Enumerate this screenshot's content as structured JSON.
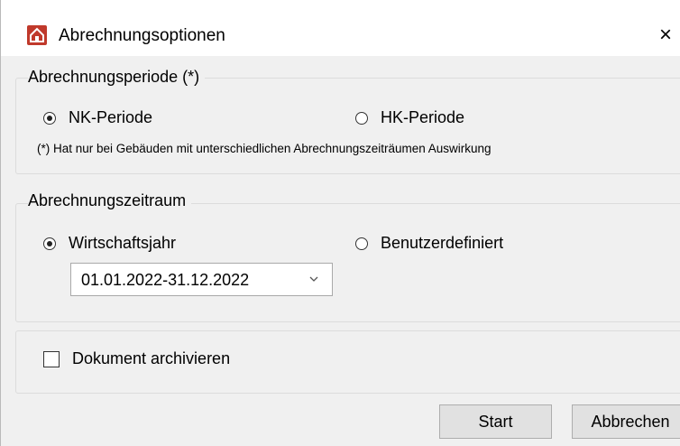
{
  "window": {
    "title": "Abrechnungsoptionen",
    "close_symbol": "×"
  },
  "period": {
    "legend": "Abrechnungsperiode (*)",
    "options": [
      {
        "label": "NK-Periode",
        "checked": true
      },
      {
        "label": "HK-Periode",
        "checked": false
      }
    ],
    "note": "(*) Hat nur bei Gebäuden mit unterschiedlichen Abrechnungszeiträumen Auswirkung"
  },
  "range": {
    "legend": "Abrechnungszeitraum",
    "options": [
      {
        "label": "Wirtschaftsjahr",
        "checked": true
      },
      {
        "label": "Benutzerdefiniert",
        "checked": false
      }
    ],
    "select_value": "01.01.2022-31.12.2022"
  },
  "archive": {
    "label": "Dokument archivieren",
    "checked": false
  },
  "buttons": {
    "start": "Start",
    "cancel": "Abbrechen"
  }
}
